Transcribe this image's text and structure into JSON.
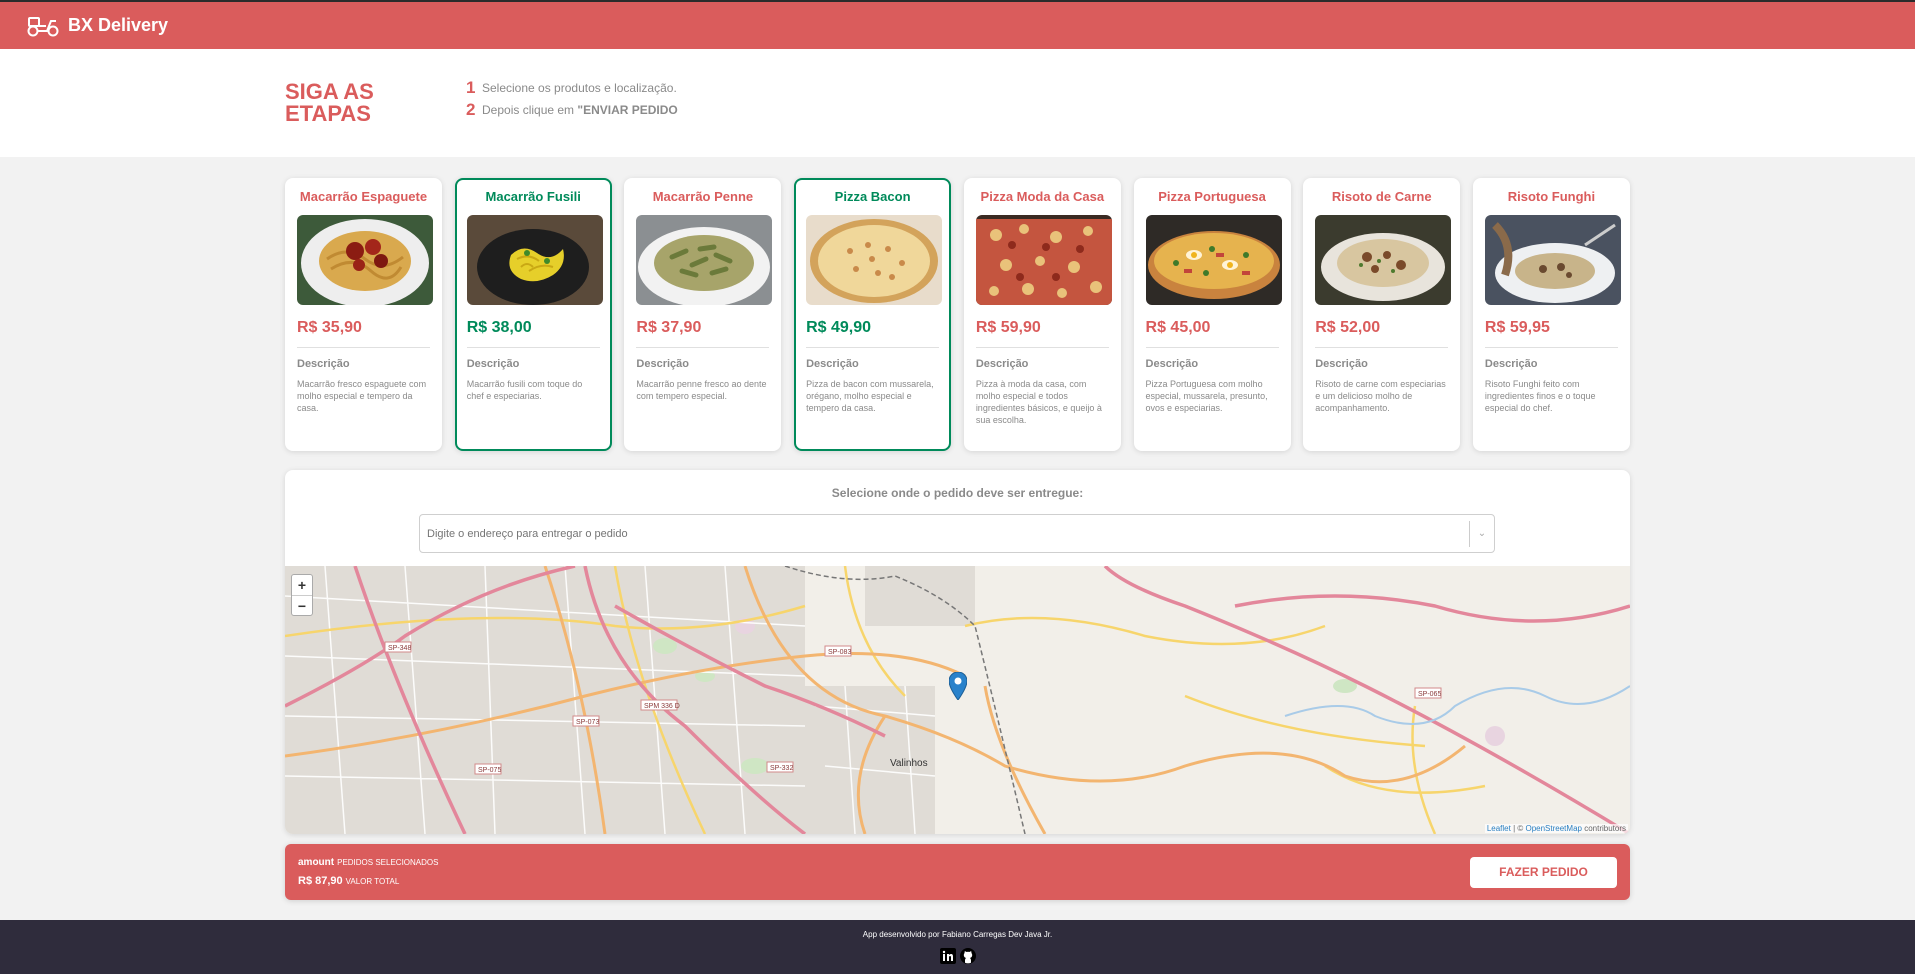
{
  "navbar": {
    "brand": "BX Delivery",
    "logo_icon": "delivery-scooter-icon"
  },
  "steps": {
    "title": "Siga as etapas",
    "items": [
      {
        "num": "1",
        "text": "Selecione os produtos e localização."
      },
      {
        "num": "2",
        "text_prefix": "Depois clique em ",
        "text_bold": "\"ENVIAR PEDIDO"
      }
    ]
  },
  "products": [
    {
      "name": "Macarrão Espaguete",
      "price": "R$ 35,90",
      "desc_title": "Descrição",
      "desc": "Macarrão fresco espaguete com molho especial e tempero da casa.",
      "selected": false
    },
    {
      "name": "Macarrão Fusili",
      "price": "R$ 38,00",
      "desc_title": "Descrição",
      "desc": "Macarrão fusili com toque do chef e especiarias.",
      "selected": true
    },
    {
      "name": "Macarrão Penne",
      "price": "R$ 37,90",
      "desc_title": "Descrição",
      "desc": "Macarrão penne fresco ao dente com tempero especial.",
      "selected": false
    },
    {
      "name": "Pizza Bacon",
      "price": "R$ 49,90",
      "desc_title": "Descrição",
      "desc": "Pizza de bacon com mussarela, orégano, molho especial e tempero da casa.",
      "selected": true
    },
    {
      "name": "Pizza Moda da Casa",
      "price": "R$ 59,90",
      "desc_title": "Descrição",
      "desc": "Pizza à moda da casa, com molho especial e todos ingredientes básicos, e queijo à sua escolha.",
      "selected": false
    },
    {
      "name": "Pizza Portuguesa",
      "price": "R$ 45,00",
      "desc_title": "Descrição",
      "desc": "Pizza Portuguesa com molho especial, mussarela, presunto, ovos e especiarias.",
      "selected": false
    },
    {
      "name": "Risoto de Carne",
      "price": "R$ 52,00",
      "desc_title": "Descrição",
      "desc": "Risoto de carne com especiarias e um delicioso molho de acompanhamento.",
      "selected": false
    },
    {
      "name": "Risoto Funghi",
      "price": "R$ 59,95",
      "desc_title": "Descrição",
      "desc": "Risoto Funghi feito com ingredientes finos e o toque especial do chef.",
      "selected": false
    }
  ],
  "location": {
    "label": "Selecione onde o pedido deve ser entregue:",
    "placeholder": "Digite o endereço para entregar o pedido",
    "map": {
      "zoom_in": "+",
      "zoom_out": "−",
      "city": "Valinhos",
      "roads": [
        "SP-348",
        "SP-083",
        "SPM 336 D",
        "SP-073",
        "SP-332",
        "SP-075",
        "SP-065"
      ],
      "attribution_leaflet": "Leaflet",
      "attribution_sep": " | © ",
      "attribution_osm": "OpenStreetMap",
      "attribution_rest": " contributors"
    }
  },
  "summary": {
    "amount": "amount",
    "amount_label": "Pedidos selecionados",
    "total": "R$ 87,90",
    "total_label": "Valor total",
    "button": "Fazer pedido"
  },
  "footer": {
    "credit": "App desenvolvido por Fabiano Carregas Dev Java Jr."
  },
  "colors": {
    "primary": "#da5c5c",
    "selected": "#008a5a",
    "footer": "#2f2c3c"
  }
}
